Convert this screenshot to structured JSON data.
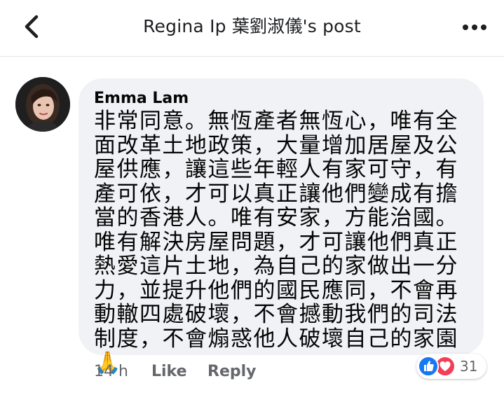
{
  "header": {
    "title": "Regina Ip 葉劉淑儀's post"
  },
  "comment": {
    "author": "Emma Lam",
    "text": "非常同意。無恆產者無恆心，唯有全面改革土地政策，大量增加居屋及公屋供應，讓這些年輕人有家可守，有產可依，才可以真正讓他們變成有擔當的香港人。唯有安家，方能治國。唯有解決房屋問題，才可讓他們真正熱愛這片土地，為自己的家做出一分力，並提升他們的國民應同，不會再動轍四處破壞，不會撼動我們的司法制度，不會煽惑他人破壞自己的家園",
    "emoji": "🙏",
    "time": "14 h",
    "like_label": "Like",
    "reply_label": "Reply",
    "reaction_count": "31"
  },
  "icons": {
    "back": "chevron-left-icon",
    "more": "more-dots-icon",
    "like_reaction": "thumbs-up-icon",
    "love_reaction": "heart-icon"
  },
  "colors": {
    "bubble": "#f0f2f5",
    "like_blue": "#1877f2",
    "love_red": "#f33e58",
    "meta_gray": "#65676b"
  }
}
